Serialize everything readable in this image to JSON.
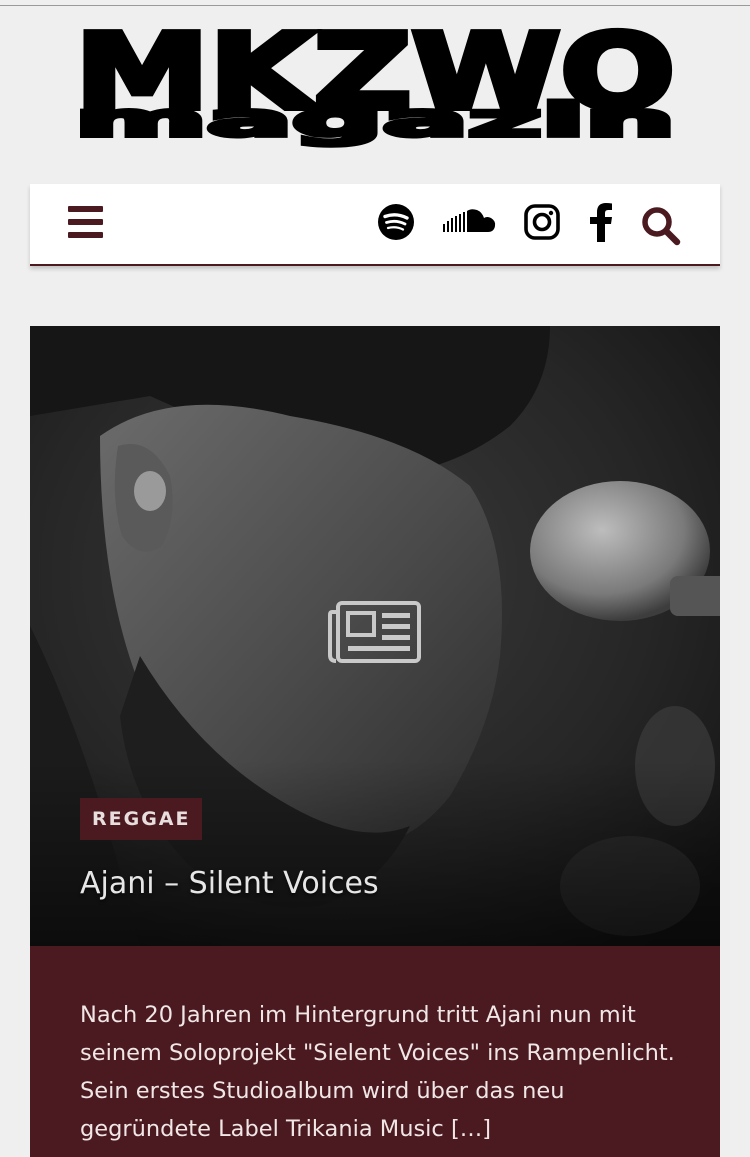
{
  "site": {
    "logo_line1": "MKZWO",
    "logo_line2": "magazin"
  },
  "nav": {
    "menu_icon": "bars-icon",
    "social": [
      {
        "name": "spotify",
        "icon": "spotify-icon"
      },
      {
        "name": "soundcloud",
        "icon": "soundcloud-icon"
      },
      {
        "name": "instagram",
        "icon": "instagram-icon"
      },
      {
        "name": "facebook",
        "icon": "facebook-icon"
      }
    ],
    "search_icon": "search-icon",
    "accent_color": "#4a1a20"
  },
  "post": {
    "category": "REGGAE",
    "title": "Ajani – Silent Voices",
    "type_icon": "newspaper-icon",
    "excerpt": "Nach 20 Jahren im Hintergrund tritt Ajani nun mit seinem Soloprojekt \"Sielent Voices\" ins Rampenlicht. Sein erstes Studioalbum wird über das neu gegründete Label Trikania Music […]"
  }
}
